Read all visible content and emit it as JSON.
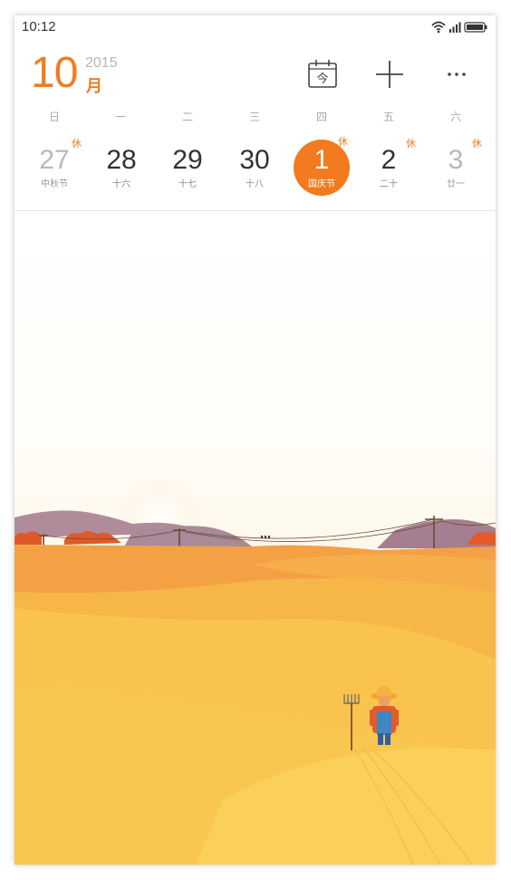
{
  "status_bar": {
    "time": "10:12",
    "icons": [
      "wifi-icon",
      "signal-icon",
      "battery-icon"
    ]
  },
  "header": {
    "month": "10",
    "year": "2015",
    "month_unit": "月",
    "today_label": "今",
    "actions": [
      "today-icon",
      "add-icon",
      "more-icon"
    ]
  },
  "weekdays": [
    "日",
    "一",
    "二",
    "三",
    "四",
    "五",
    "六"
  ],
  "dates": [
    {
      "day": "27",
      "lunar": "中秋节",
      "badge": "休",
      "dim": true,
      "selected": false
    },
    {
      "day": "28",
      "lunar": "十六",
      "badge": "",
      "dim": false,
      "selected": false
    },
    {
      "day": "29",
      "lunar": "十七",
      "badge": "",
      "dim": false,
      "selected": false
    },
    {
      "day": "30",
      "lunar": "十八",
      "badge": "",
      "dim": false,
      "selected": false
    },
    {
      "day": "1",
      "lunar": "国庆节",
      "badge": "休",
      "dim": false,
      "selected": true
    },
    {
      "day": "2",
      "lunar": "二十",
      "badge": "休",
      "dim": false,
      "selected": false
    },
    {
      "day": "3",
      "lunar": "廿一",
      "badge": "休",
      "dim": true,
      "selected": false
    }
  ],
  "colors": {
    "accent": "#f07d22",
    "selected_circle": "#f37a1f"
  },
  "illustration": {
    "subject": "autumn-field-scene"
  }
}
